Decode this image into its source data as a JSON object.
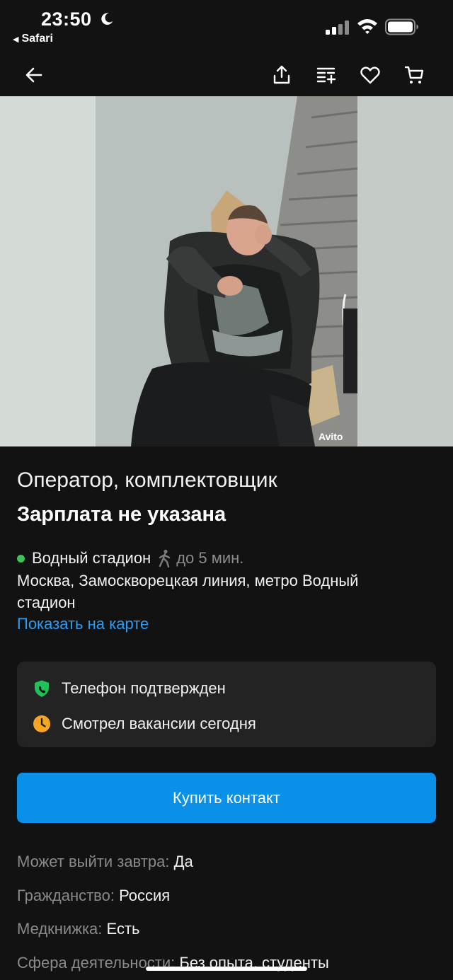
{
  "status_bar": {
    "time": "23:50",
    "back_app": "Safari",
    "icons": [
      "moon-icon",
      "signal-icon",
      "wifi-icon",
      "battery-icon"
    ]
  },
  "nav": {
    "icons": [
      "back-arrow-icon",
      "share-icon",
      "compare-icon",
      "favorite-heart-icon",
      "cart-icon"
    ]
  },
  "photo": {
    "watermark": "Avito"
  },
  "listing": {
    "title": "Оператор, комплектовщик",
    "salary": "Зарплата не указана",
    "metro_station": "Водный стадион",
    "walk_time": "до 5 мин.",
    "address": "Москва, Замоскворецкая линия, метро Водный стадион",
    "map_link": "Показать на карте"
  },
  "badges": {
    "phone_verified": "Телефон подтвержден",
    "viewed_today": "Смотрел вакансии сегодня"
  },
  "actions": {
    "buy_contact": "Купить контакт"
  },
  "details": [
    {
      "label": "Может выйти завтра:",
      "value": "Да"
    },
    {
      "label": "Гражданство:",
      "value": "Россия"
    },
    {
      "label": "Медкнижка:",
      "value": "Есть"
    },
    {
      "label": "Сфера деятельности:",
      "value": "Без опыта, студенты"
    }
  ],
  "colors": {
    "background": "#121212",
    "accent_blue": "#0a90e8",
    "link_blue": "#2e9cf2",
    "metro_green": "#3dbf5a",
    "card_bg": "#232323",
    "shield_green": "#21c05a",
    "clock_orange": "#f5a623"
  }
}
